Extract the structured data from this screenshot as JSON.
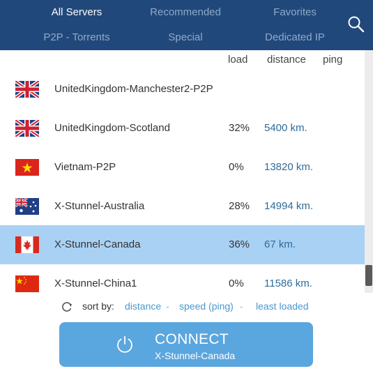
{
  "tabs": {
    "all_servers": "All Servers",
    "recommended": "Recommended",
    "favorites": "Favorites",
    "p2p_torrents": "P2P - Torrents",
    "special": "Special",
    "dedicated_ip": "Dedicated IP"
  },
  "columns": {
    "load": "load",
    "distance": "distance",
    "ping": "ping"
  },
  "servers": [
    {
      "name": "UnitedKingdom-Manchester2-P2P",
      "load": "",
      "distance": "",
      "flag": "gb-flag-icon"
    },
    {
      "name": "UnitedKingdom-Scotland",
      "load": "32%",
      "distance": "5400 km.",
      "flag": "gb-flag-icon"
    },
    {
      "name": "Vietnam-P2P",
      "load": "0%",
      "distance": "13820 km.",
      "flag": "vn-flag-icon"
    },
    {
      "name": "X-Stunnel-Australia",
      "load": "28%",
      "distance": "14994 km.",
      "flag": "au-flag-icon"
    },
    {
      "name": "X-Stunnel-Canada",
      "load": "36%",
      "distance": "67 km.",
      "flag": "ca-flag-icon",
      "selected": true
    },
    {
      "name": "X-Stunnel-China1",
      "load": "0%",
      "distance": "11586 km.",
      "flag": "cn-flag-icon"
    }
  ],
  "sort": {
    "label": "sort by:",
    "distance": "distance",
    "speed": "speed (ping)",
    "least_loaded": "least loaded",
    "separator": "-"
  },
  "connect": {
    "label": "CONNECT",
    "server": "X-Stunnel-Canada"
  },
  "colors": {
    "header_bg": "#21487a",
    "selected_row": "#a9d1f4",
    "connect_button": "#5aa6df",
    "link": "#4a97cf"
  },
  "icons": {
    "search": "search-icon",
    "refresh": "refresh-icon",
    "power": "power-icon"
  }
}
